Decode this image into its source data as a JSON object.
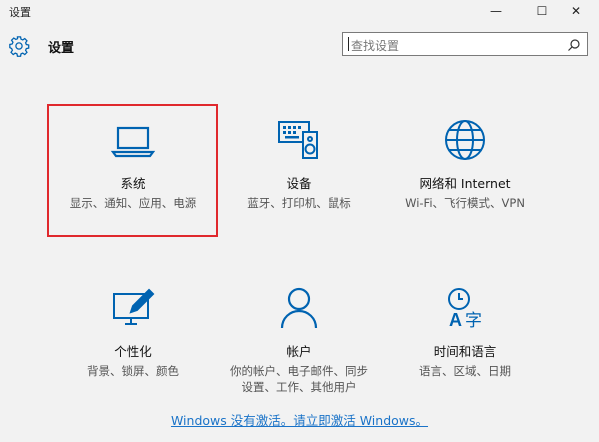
{
  "window": {
    "title": "设置",
    "minimize_glyph": "—",
    "maximize_glyph": "☐",
    "close_glyph": "✕"
  },
  "header": {
    "title": "设置",
    "icon": "gear-icon"
  },
  "search": {
    "placeholder": "查找设置",
    "icon": "search-icon"
  },
  "tiles": [
    {
      "label": "系统",
      "desc": "显示、通知、应用、电源",
      "icon": "laptop-icon",
      "selected": true
    },
    {
      "label": "设备",
      "desc": "蓝牙、打印机、鼠标",
      "icon": "devices-icon"
    },
    {
      "label": "网络和 Internet",
      "desc": "Wi-Fi、飞行模式、VPN",
      "icon": "globe-icon"
    },
    {
      "label": "个性化",
      "desc": "背景、锁屏、颜色",
      "icon": "personalization-icon"
    },
    {
      "label": "帐户",
      "desc": "你的帐户、电子邮件、同步设置、工作、其他用户",
      "icon": "account-icon"
    },
    {
      "label": "时间和语言",
      "desc": "语言、区域、日期",
      "icon": "time-language-icon"
    }
  ],
  "activation": {
    "text": "Windows 没有激活。请立即激活 Windows。"
  },
  "colors": {
    "accent": "#0063b1",
    "selection": "#e0282d",
    "link": "#1a73c8",
    "background": "#f2f2f2"
  }
}
